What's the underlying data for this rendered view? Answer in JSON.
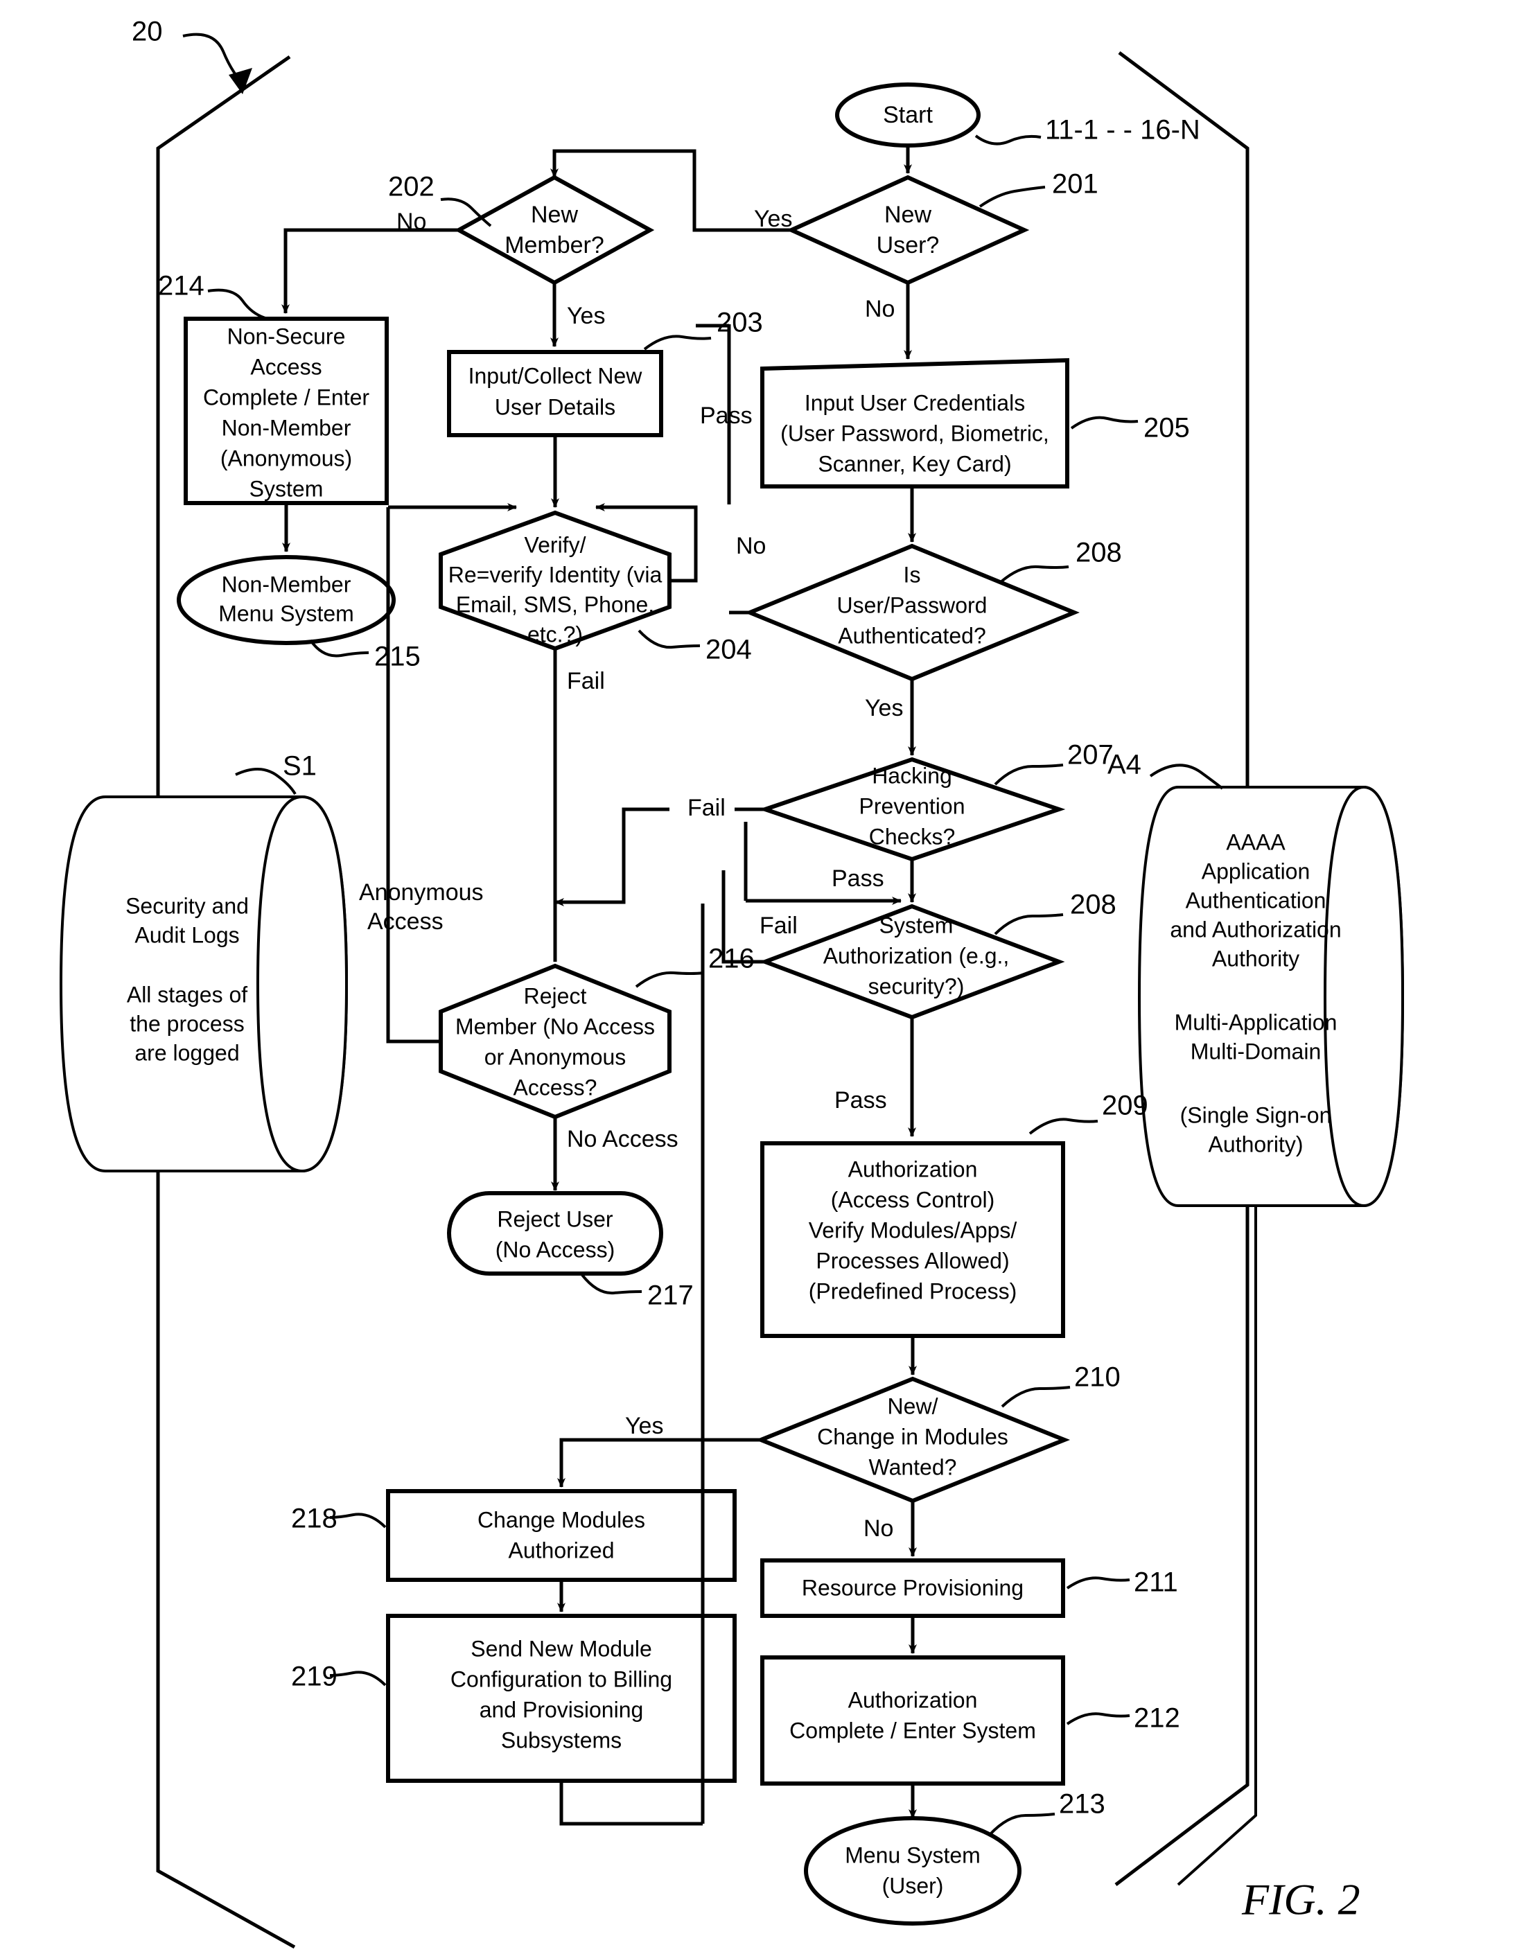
{
  "figure": {
    "label": "FIG. 2",
    "system_ref": "20",
    "start_ref": "11-1 - - 16-N"
  },
  "nodes": {
    "start": {
      "ref": "",
      "text": [
        "Start"
      ],
      "shape": "oval"
    },
    "n201": {
      "ref": "201",
      "text": [
        "New",
        "User?"
      ],
      "shape": "diamond"
    },
    "n202": {
      "ref": "202",
      "text": [
        "New",
        "Member?"
      ],
      "shape": "diamond"
    },
    "n203": {
      "ref": "203",
      "text": [
        "Input/Collect New",
        "User Details"
      ],
      "shape": "rect"
    },
    "n204": {
      "ref": "204",
      "text": [
        "Verify/",
        "Re=verify Identity (via",
        "Email, SMS, Phone,",
        "etc.?)"
      ],
      "shape": "hexagon"
    },
    "n205": {
      "ref": "205",
      "text": [
        "Input User Credentials",
        "(User Password, Biometric,",
        "Scanner, Key Card)"
      ],
      "shape": "rect"
    },
    "n206": {
      "ref": "208",
      "text": [
        "Is",
        "User/Password",
        "Authenticated?"
      ],
      "shape": "diamond"
    },
    "n207": {
      "ref": "207",
      "text": [
        "Hacking",
        "Prevention",
        "Checks?"
      ],
      "shape": "diamond"
    },
    "n208": {
      "ref": "208",
      "text": [
        "System",
        "Authorization (e.g.,",
        "security?)"
      ],
      "shape": "diamond"
    },
    "n209": {
      "ref": "209",
      "text": [
        "Authorization",
        "(Access Control)",
        "Verify Modules/Apps/",
        "Processes Allowed)",
        "(Predefined Process)"
      ],
      "shape": "rect"
    },
    "n210": {
      "ref": "210",
      "text": [
        "New/",
        "Change in Modules",
        "Wanted?"
      ],
      "shape": "diamond"
    },
    "n211": {
      "ref": "211",
      "text": [
        "Resource Provisioning"
      ],
      "shape": "rect"
    },
    "n212": {
      "ref": "212",
      "text": [
        "Authorization",
        "Complete / Enter System"
      ],
      "shape": "rect"
    },
    "n213": {
      "ref": "213",
      "text": [
        "Menu System",
        "(User)"
      ],
      "shape": "oval"
    },
    "n214": {
      "ref": "214",
      "text": [
        "Non-Secure",
        "Access",
        "Complete / Enter",
        "Non-Member",
        "(Anonymous)",
        "System"
      ],
      "shape": "rect"
    },
    "n215": {
      "ref": "215",
      "text": [
        "Non-Member",
        "Menu System"
      ],
      "shape": "oval"
    },
    "n216": {
      "ref": "216",
      "text": [
        "Reject",
        "Member (No Access",
        "or Anonymous",
        "Access?"
      ],
      "shape": "hexagon"
    },
    "n217": {
      "ref": "217",
      "text": [
        "Reject User",
        "(No Access)"
      ],
      "shape": "stadium"
    },
    "n218": {
      "ref": "218",
      "text": [
        "Change Modules",
        "Authorized"
      ],
      "shape": "rect"
    },
    "n219": {
      "ref": "219",
      "text": [
        "Send New Module",
        "Configuration to Billing",
        "and Provisioning",
        "Subsystems"
      ],
      "shape": "rect"
    },
    "s1": {
      "ref": "S1",
      "text": [
        "Security and",
        "Audit Logs",
        "",
        "All stages of",
        "the process",
        "are logged"
      ],
      "shape": "cylinder"
    },
    "a4": {
      "ref": "A4",
      "text": [
        "AAAA",
        "Application",
        "Authentication",
        "and Authorization",
        "Authority",
        "",
        "Multi-Application",
        "Multi-Domain",
        "",
        "(Single Sign-on",
        "Authority)"
      ],
      "shape": "cylinder"
    }
  },
  "edge_labels": {
    "yes_201": "Yes",
    "no_201": "No",
    "no_202": "No",
    "yes_202": "Yes",
    "pass_203": "Pass",
    "no_204": "No",
    "fail_204": "Fail",
    "yes_206": "Yes",
    "fail_207": "Fail",
    "pass_207": "Pass",
    "fail_208": "Fail",
    "pass_208": "Pass",
    "yes_210": "Yes",
    "no_210": "No",
    "no_access_216": "No Access",
    "anonymous_access": [
      "Anonymous",
      "Access"
    ]
  }
}
